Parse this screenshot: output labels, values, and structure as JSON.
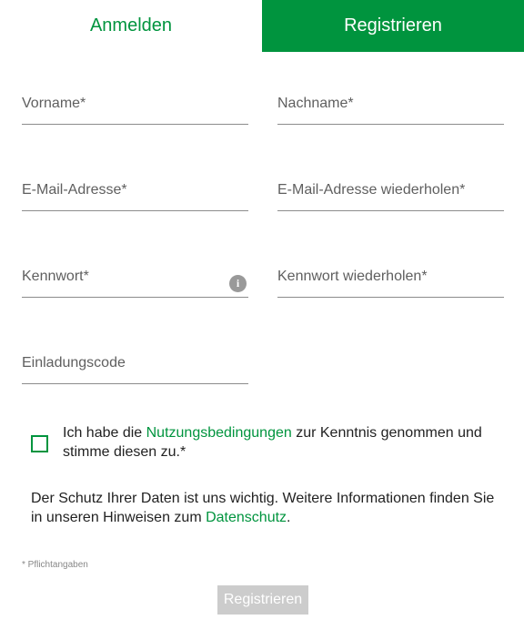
{
  "tabs": {
    "login_label": "Anmelden",
    "register_label": "Registrieren"
  },
  "form": {
    "first_name_placeholder": "Vorname*",
    "last_name_placeholder": "Nachname*",
    "email_placeholder": "E-Mail-Adresse*",
    "email_repeat_placeholder": "E-Mail-Adresse wiederholen*",
    "password_placeholder": "Kennwort*",
    "password_repeat_placeholder": "Kennwort wiederholen*",
    "invitation_code_placeholder": "Einladungscode",
    "password_info_icon": "info-icon",
    "password_info_glyph": "i"
  },
  "consent": {
    "checked": false,
    "text_before": "Ich habe die ",
    "link_label": "Nutzungsbedingungen",
    "text_after": " zur Kenntnis genommen und stimme diesen zu.*"
  },
  "privacy": {
    "text_before": "Der Schutz Ihrer Daten ist uns wichtig. Weitere Informationen finden Sie in unseren Hinweisen zum ",
    "link_label": "Datenschutz",
    "text_after": "."
  },
  "required_note": "* Pflichtangaben",
  "submit_label": "Registrieren",
  "colors": {
    "accent": "#00943e",
    "button_disabled": "#cccccc",
    "field_border": "#8c8c8c"
  }
}
